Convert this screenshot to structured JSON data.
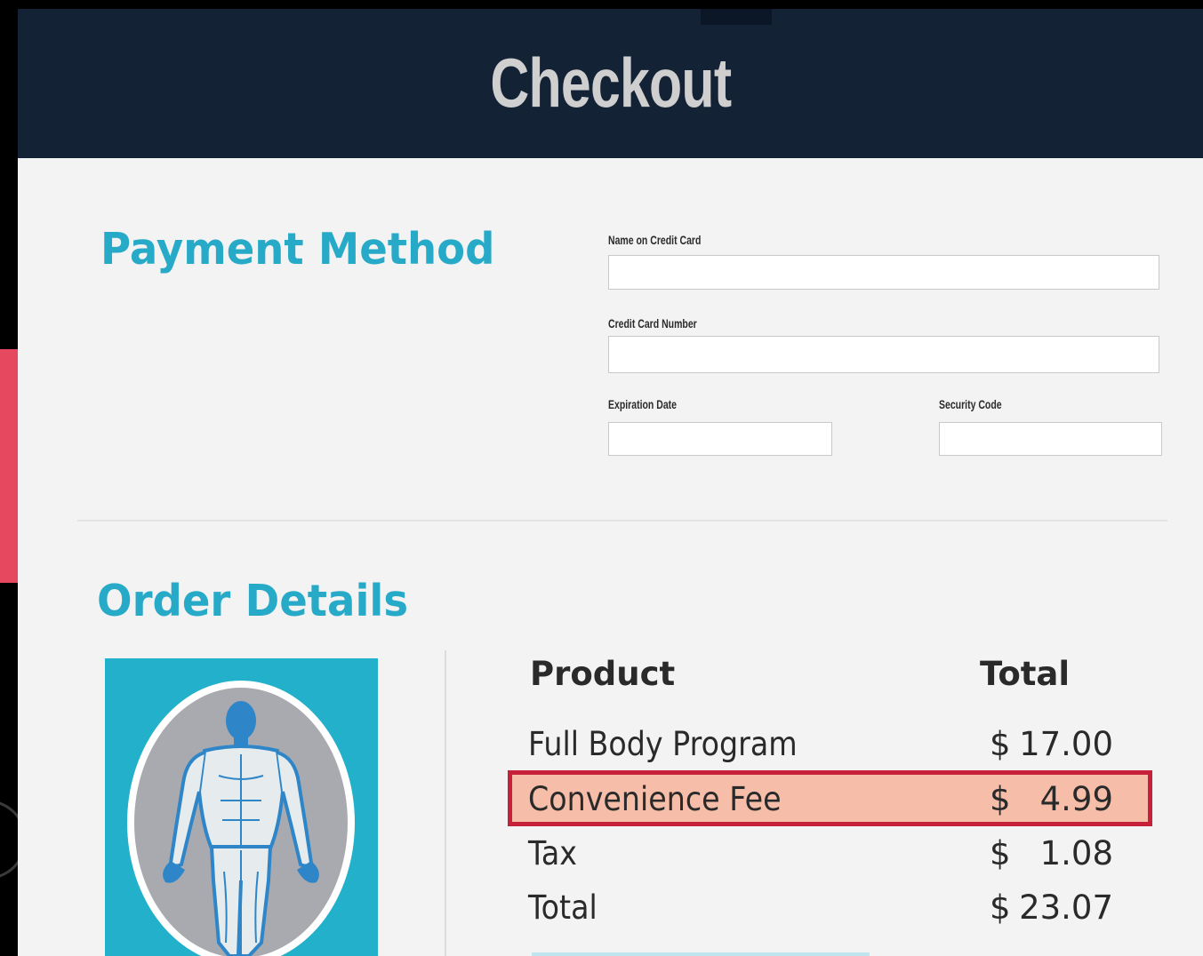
{
  "header": {
    "title": "Checkout"
  },
  "payment": {
    "heading": "Payment Method",
    "fields": {
      "name_label": "Name on Credit Card",
      "name_value": "",
      "number_label": "Credit Card Number",
      "number_value": "",
      "expiration_label": "Expiration Date",
      "expiration_value": "",
      "security_label": "Security Code",
      "security_value": ""
    }
  },
  "order": {
    "heading": "Order Details",
    "image_icon": "human-anatomy-icon",
    "columns": {
      "product": "Product",
      "total": "Total"
    },
    "rows": [
      {
        "product": "Full Body Program",
        "currency": "$",
        "amount": "17.00"
      },
      {
        "product": "Convenience Fee",
        "currency": "$",
        "amount": "4.99"
      },
      {
        "product": "Tax",
        "currency": "$",
        "amount": "1.08"
      },
      {
        "product": "Total",
        "currency": "$",
        "amount": "23.07"
      }
    ]
  },
  "colors": {
    "header_bg": "#142235",
    "accent": "#27aac8",
    "highlight_fill": "#f6bda8",
    "highlight_border": "#c6203b"
  }
}
